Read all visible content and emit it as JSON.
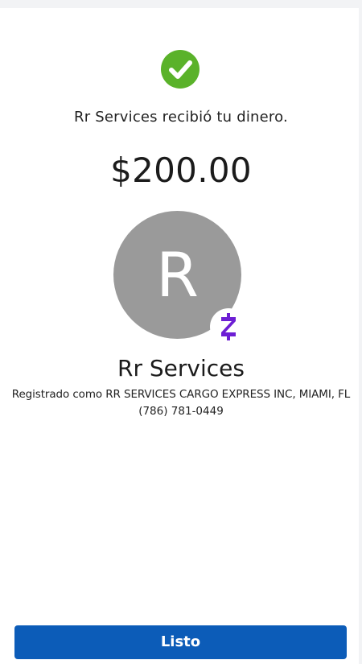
{
  "colors": {
    "success": "#5ab22a",
    "avatar": "#9a9a9a",
    "zelle_purple": "#6d1ed4",
    "button": "#0c5cb8"
  },
  "status": {
    "icon": "check-circle-icon",
    "message": "Rr Services recibió tu dinero."
  },
  "payment": {
    "amount": "$200.00"
  },
  "recipient": {
    "initial": "R",
    "name": "Rr Services",
    "registered_as": "Registrado como RR SERVICES CARGO EXPRESS INC, MIAMI, FL",
    "phone": "(786) 781-0449",
    "badge_icon": "zelle-icon"
  },
  "actions": {
    "done_label": "Listo"
  }
}
